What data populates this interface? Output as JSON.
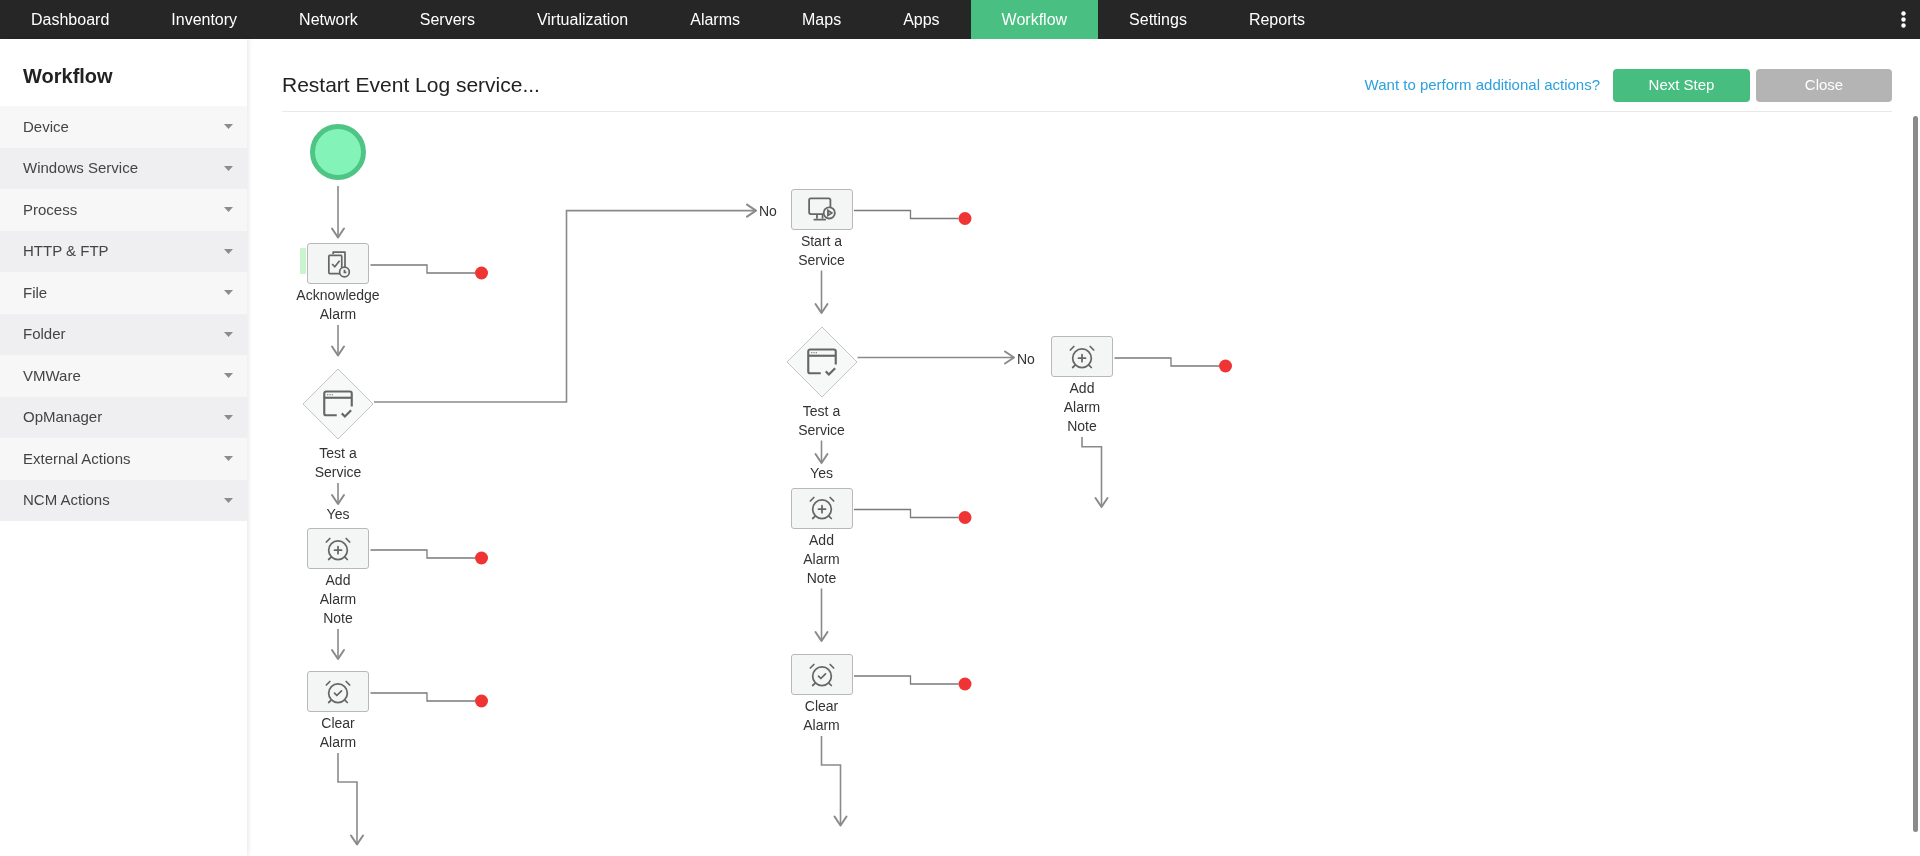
{
  "top_nav": {
    "items": [
      {
        "label": "Dashboard",
        "selected": false
      },
      {
        "label": "Inventory",
        "selected": false
      },
      {
        "label": "Network",
        "selected": false
      },
      {
        "label": "Servers",
        "selected": false
      },
      {
        "label": "Virtualization",
        "selected": false
      },
      {
        "label": "Alarms",
        "selected": false
      },
      {
        "label": "Maps",
        "selected": false
      },
      {
        "label": "Apps",
        "selected": false
      },
      {
        "label": "Workflow",
        "selected": true
      },
      {
        "label": "Settings",
        "selected": false
      },
      {
        "label": "Reports",
        "selected": false
      }
    ]
  },
  "sidebar": {
    "title": "Workflow",
    "items": [
      {
        "label": "Device",
        "expanded": false
      },
      {
        "label": "Windows Service",
        "expanded": false
      },
      {
        "label": "Process",
        "expanded": false
      },
      {
        "label": "HTTP & FTP",
        "expanded": false
      },
      {
        "label": "File",
        "expanded": false
      },
      {
        "label": "Folder",
        "expanded": false
      },
      {
        "label": "VMWare",
        "expanded": false
      },
      {
        "label": "OpManager",
        "expanded": false
      },
      {
        "label": "External Actions",
        "expanded": false
      },
      {
        "label": "NCM Actions",
        "expanded": false
      }
    ]
  },
  "header": {
    "title": "Restart Event Log service...",
    "link": "Want to perform additional actions?",
    "buttons": [
      {
        "label": "Next Step",
        "kind": "primary"
      },
      {
        "label": "Close",
        "kind": "secondary"
      }
    ]
  },
  "workflow": {
    "nodes": [
      {
        "kind": "start"
      },
      {
        "kind": "action",
        "label": "Acknowledge Alarm",
        "highlighted": true
      },
      {
        "kind": "decision",
        "label": "Test a Service",
        "yes_label": "Yes",
        "no_label": "No"
      },
      {
        "kind": "action",
        "label": "Add Alarm Note",
        "highlighted": false
      },
      {
        "kind": "action",
        "label": "Clear Alarm",
        "highlighted": false
      },
      {
        "kind": "action",
        "label": "Start a Service",
        "highlighted": false
      },
      {
        "kind": "decision",
        "label": "Test a Service",
        "yes_label": "Yes",
        "no_label": "No"
      },
      {
        "kind": "action",
        "label": "Add Alarm Note",
        "highlighted": false
      },
      {
        "kind": "action",
        "label": "Clear Alarm",
        "highlighted": false
      },
      {
        "kind": "action",
        "label": "Add Alarm Note",
        "highlighted": false
      }
    ]
  }
}
